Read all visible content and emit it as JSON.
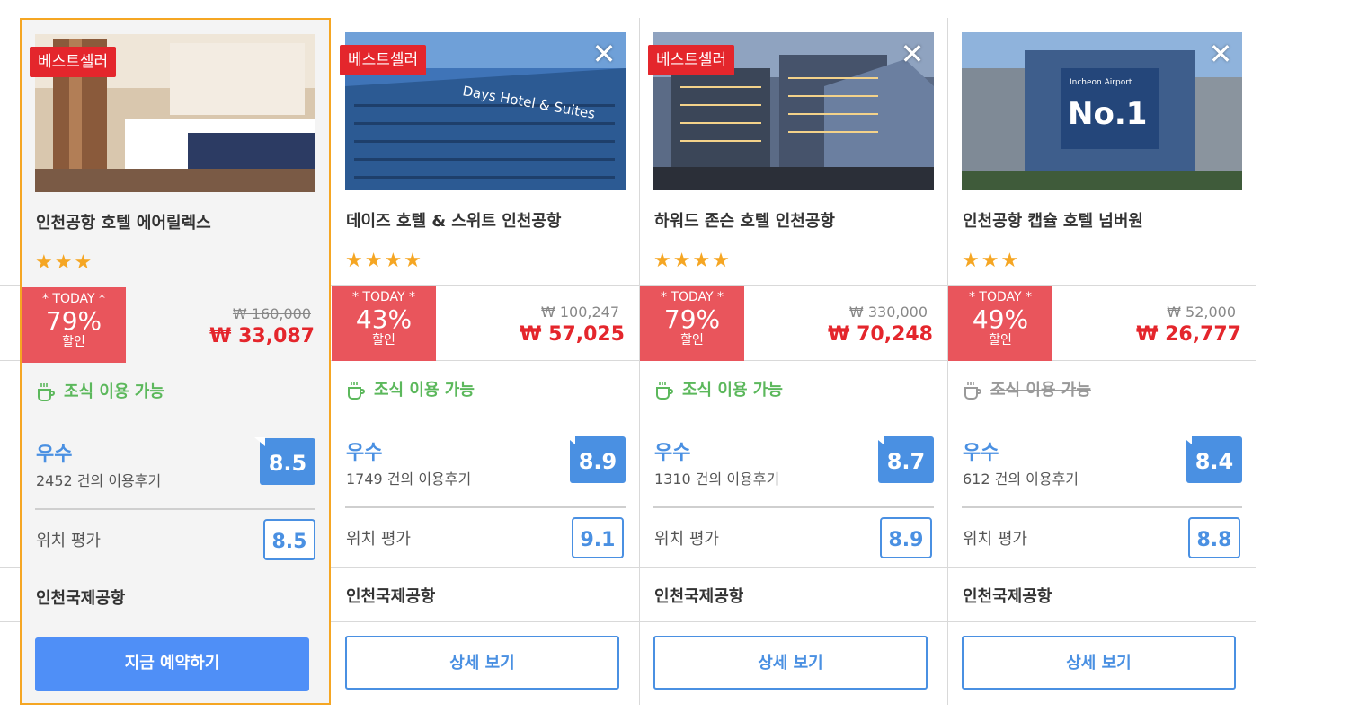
{
  "hotels": [
    {
      "badge": "베스트셀러",
      "name": "인천공항 호텔 에어릴렉스",
      "stars": "★★★",
      "today_label": "* TODAY *",
      "discount": "79%",
      "discount_label": "할인",
      "original_price": "₩ 160,000",
      "price": "₩ 33,087",
      "breakfast": "조식 이용 가능",
      "breakfast_available": true,
      "grade": "우수",
      "reviews": "2452 건의 이용후기",
      "score": "8.5",
      "location_label": "위치 평가",
      "location_score": "8.5",
      "area": "인천국제공항",
      "button": "지금 예약하기",
      "button_primary": true,
      "has_close": false
    },
    {
      "badge": "베스트셀러",
      "name": "데이즈 호텔 & 스위트 인천공항",
      "stars": "★★★★",
      "today_label": "* TODAY *",
      "discount": "43%",
      "discount_label": "할인",
      "original_price": "₩ 100,247",
      "price": "₩ 57,025",
      "breakfast": "조식 이용 가능",
      "breakfast_available": true,
      "grade": "우수",
      "reviews": "1749 건의 이용후기",
      "score": "8.9",
      "location_label": "위치 평가",
      "location_score": "9.1",
      "area": "인천국제공항",
      "button": "상세 보기",
      "button_primary": false,
      "has_close": true
    },
    {
      "badge": "베스트셀러",
      "name": "하워드 존슨 호텔 인천공항",
      "stars": "★★★★",
      "today_label": "* TODAY *",
      "discount": "79%",
      "discount_label": "할인",
      "original_price": "₩ 330,000",
      "price": "₩ 70,248",
      "breakfast": "조식 이용 가능",
      "breakfast_available": true,
      "grade": "우수",
      "reviews": "1310 건의 이용후기",
      "score": "8.7",
      "location_label": "위치 평가",
      "location_score": "8.9",
      "area": "인천국제공항",
      "button": "상세 보기",
      "button_primary": false,
      "has_close": true
    },
    {
      "badge": "",
      "name": "인천공항 캡슐 호텔 넘버원",
      "stars": "★★★",
      "today_label": "* TODAY *",
      "discount": "49%",
      "discount_label": "할인",
      "original_price": "₩ 52,000",
      "price": "₩ 26,777",
      "breakfast": "조식 이용 가능",
      "breakfast_available": false,
      "grade": "우수",
      "reviews": "612 건의 이용후기",
      "score": "8.4",
      "location_label": "위치 평가",
      "location_score": "8.8",
      "area": "인천국제공항",
      "button": "상세 보기",
      "button_primary": false,
      "has_close": true
    }
  ],
  "close_symbol": "✕",
  "colors": {
    "accent_blue": "#4a90e2",
    "badge_red": "#e4262c",
    "today_red": "#e9555c",
    "breakfast_green": "#5cb85c",
    "selected_border": "#f5a623",
    "star": "#f5a623"
  },
  "icons": {
    "breakfast": "coffee-cup-icon",
    "close": "close-icon",
    "star": "star-icon"
  },
  "photo_texts": {
    "hotel2_sign": "Days Hotel & Suites",
    "hotel4_sign_line1": "Incheon Airport",
    "hotel4_sign_main": "No.1"
  }
}
